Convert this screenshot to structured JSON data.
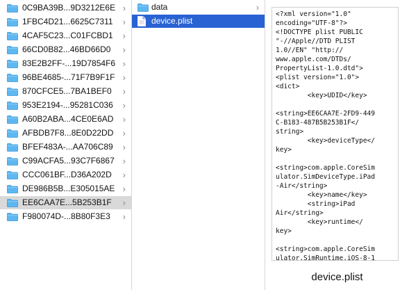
{
  "column1": {
    "items": [
      {
        "label": "0C9BA39B...9D3212E6E"
      },
      {
        "label": "1FBC4D21...6625C7311"
      },
      {
        "label": "4CAF5C23...C01FCBD1"
      },
      {
        "label": "66CD0B82...46BD66D0"
      },
      {
        "label": "83E2B2FF-...19D7854F6"
      },
      {
        "label": "96BE4685-...71F7B9F1F"
      },
      {
        "label": "870CFCE5...7BA1BEF0"
      },
      {
        "label": "953E2194-...95281C036"
      },
      {
        "label": "A60B2ABA...4CE0E6AD"
      },
      {
        "label": "AFBDB7F8...8E0D22DD"
      },
      {
        "label": "BFEF483A-...AA706C89"
      },
      {
        "label": "C99ACFA5...93C7F6867"
      },
      {
        "label": "CCC061BF...D36A202D"
      },
      {
        "label": "DE986B5B...E305015AE"
      },
      {
        "label": "EE6CAA7E...5B253B1F"
      },
      {
        "label": "F980074D-...8B80F3E3"
      }
    ],
    "selected_index": 14
  },
  "column2": {
    "items": [
      {
        "label": "data",
        "type": "folder"
      },
      {
        "label": "device.plist",
        "type": "file"
      }
    ],
    "selected_index": 1
  },
  "preview": {
    "content": "<?xml version=\"1.0\"\nencoding=\"UTF-8\"?>\n<!DOCTYPE plist PUBLIC\n\"-//Apple//DTD PLIST\n1.0//EN\" \"http://\nwww.apple.com/DTDs/\nPropertyList-1.0.dtd\">\n<plist version=\"1.0\">\n<dict>\n        <key>UDID</key>\n\n<string>EE6CAA7E-2FD9-449\nC-B183-487B5B253B1F</\nstring>\n        <key>deviceType</\nkey>\n\n<string>com.apple.CoreSim\nulator.SimDeviceType.iPad\n-Air</string>\n        <key>name</key>\n        <string>iPad\nAir</string>\n        <key>runtime</\nkey>\n\n<string>com.apple.CoreSim\nulator.SimRuntime.iOS-8-1",
    "filename": "device.plist"
  },
  "icons": {
    "folder": "folder-icon",
    "file": "document-icon",
    "chevron": "chevron-right-icon"
  },
  "colors": {
    "folder_blue": "#5eb7f0",
    "selection_blue": "#2962d3",
    "selection_gray": "#d9d9d9"
  }
}
